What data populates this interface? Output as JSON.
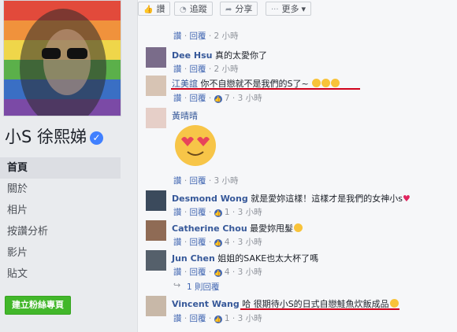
{
  "profile": {
    "name": "小S 徐熙娣",
    "verified_icon": "check-icon",
    "nav": [
      "首頁",
      "關於",
      "相片",
      "按讚分析",
      "影片",
      "貼文"
    ],
    "create_page": "建立粉絲專頁"
  },
  "action_bar": {
    "like": "讚",
    "follow": "追蹤",
    "share": "分享",
    "more": "更多"
  },
  "comments": [
    {
      "id": "c0",
      "name": "",
      "text": "",
      "like": "讚",
      "reply": "回覆",
      "time": "2 小時",
      "likes": ""
    },
    {
      "id": "c1",
      "name": "Dee Hsu",
      "text": "真的太愛你了",
      "like": "讚",
      "reply": "回覆",
      "time": "2 小時",
      "likes": ""
    },
    {
      "id": "c2",
      "name": "江美誼",
      "text": "你不自戀就不是我們的S了~",
      "like": "讚",
      "reply": "回覆",
      "time": "3 小時",
      "likes": "7"
    },
    {
      "id": "c3",
      "name": "黃晴晴",
      "text": "",
      "like": "讚",
      "reply": "回覆",
      "time": "3 小時",
      "likes": ""
    },
    {
      "id": "c4",
      "name": "Desmond Wong",
      "text": "就是愛妳這樣！這樣才是我們的女神小s",
      "like": "讚",
      "reply": "回覆",
      "time": "3 小時",
      "likes": "1"
    },
    {
      "id": "c5",
      "name": "Catherine Chou",
      "text": "最愛妳甩髮",
      "like": "讚",
      "reply": "回覆",
      "time": "3 小時",
      "likes": "4"
    },
    {
      "id": "c6",
      "name": "Jun Chen",
      "text": "姐姐的SAKE也太大杯了嗎",
      "like": "讚",
      "reply": "回覆",
      "time": "3 小時",
      "likes": "4"
    },
    {
      "id": "c7",
      "name": "Vincent Wang",
      "text": "哈 很期待小S的日式自戀鮭魚炊飯成品",
      "like": "讚",
      "reply": "回覆",
      "time": "3 小時",
      "likes": "1"
    }
  ],
  "reply_thread": "1 則回覆",
  "colors": {
    "link": "#365899",
    "meta": "#90949c",
    "underline": "#d0021b",
    "green": "#42b72a"
  }
}
